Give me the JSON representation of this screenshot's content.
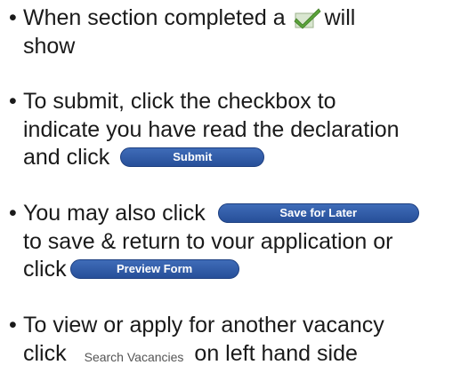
{
  "bullets": {
    "completed": {
      "line1_before": "When section completed a",
      "line1_after": "will",
      "line2": "show"
    },
    "submit": {
      "line1": "To submit, click the checkbox to",
      "line2": "indicate you have read the declaration",
      "line3": "and click",
      "button_label": "Submit"
    },
    "save": {
      "line1": "You may also click",
      "save_button_label": "Save for Later",
      "line2": "to save & return to vour application or",
      "line3": "click",
      "preview_button_label": "Preview Form"
    },
    "search": {
      "line1": "To view or apply for another vacancy",
      "line2_before": "click",
      "link_label": "Search Vacancies",
      "line2_after": "on left hand side"
    }
  },
  "bullet_char": "•",
  "colors": {
    "button_blue": "#2f5ba8",
    "checkmark_green": "#5aa33a",
    "text": "#1a1a1a"
  }
}
